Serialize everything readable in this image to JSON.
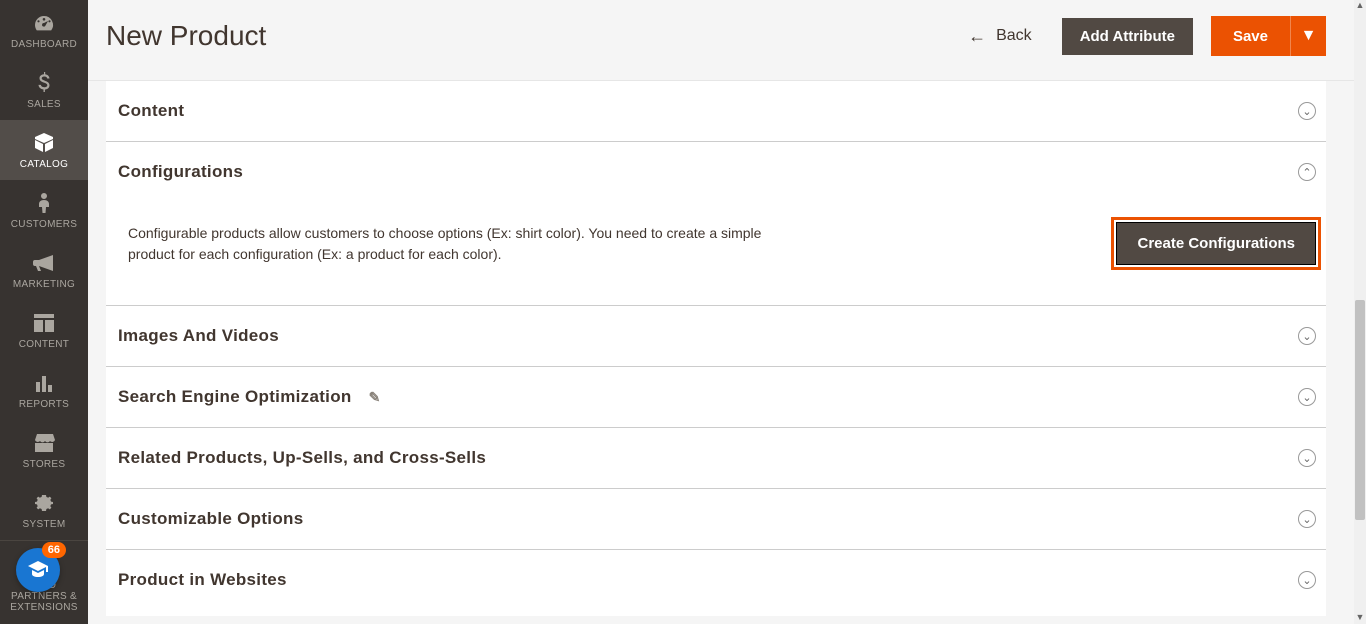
{
  "sidebar": {
    "items": [
      {
        "label": "DASHBOARD",
        "icon": "gauge"
      },
      {
        "label": "SALES",
        "icon": "dollar"
      },
      {
        "label": "CATALOG",
        "icon": "box"
      },
      {
        "label": "CUSTOMERS",
        "icon": "person"
      },
      {
        "label": "MARKETING",
        "icon": "megaphone"
      },
      {
        "label": "CONTENT",
        "icon": "layout"
      },
      {
        "label": "REPORTS",
        "icon": "bars"
      },
      {
        "label": "STORES",
        "icon": "storefront"
      },
      {
        "label": "SYSTEM",
        "icon": "gear"
      },
      {
        "label": "FIND PARTNERS & EXTENSIONS",
        "icon": "partners"
      }
    ],
    "help_badge": "66"
  },
  "header": {
    "title": "New Product",
    "back_label": "Back",
    "add_attribute_label": "Add Attribute",
    "save_label": "Save"
  },
  "sections": {
    "content": {
      "title": "Content"
    },
    "configurations": {
      "title": "Configurations",
      "description": "Configurable products allow customers to choose options (Ex: shirt color). You need to create a simple product for each configuration (Ex: a product for each color).",
      "create_button": "Create Configurations"
    },
    "images": {
      "title": "Images And Videos"
    },
    "seo": {
      "title": "Search Engine Optimization"
    },
    "related": {
      "title": "Related Products, Up-Sells, and Cross-Sells"
    },
    "custom": {
      "title": "Customizable Options"
    },
    "websites": {
      "title": "Product in Websites"
    }
  }
}
